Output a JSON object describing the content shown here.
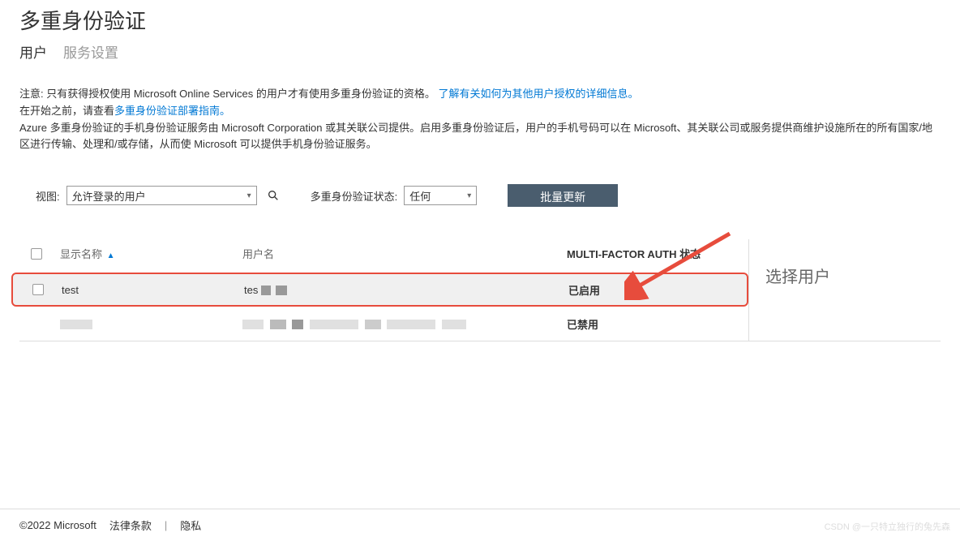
{
  "header": {
    "title": "多重身份验证",
    "tabs": {
      "users": "用户",
      "service_settings": "服务设置"
    }
  },
  "notice": {
    "line1_prefix": "注意: 只有获得授权使用 Microsoft Online Services 的用户才有使用多重身份验证的资格。 ",
    "line1_link": "了解有关如何为其他用户授权的详细信息。",
    "line2_prefix": "在开始之前，请查看",
    "line2_link": "多重身份验证部署指南。",
    "line3": "Azure 多重身份验证的手机身份验证服务由 Microsoft Corporation 或其关联公司提供。启用多重身份验证后，用户的手机号码可以在 Microsoft、其关联公司或服务提供商维护设施所在的所有国家/地区进行传输、处理和/或存储，从而使 Microsoft 可以提供手机身份验证服务。"
  },
  "toolbar": {
    "view_label": "视图:",
    "view_value": "允许登录的用户",
    "mfa_status_label": "多重身份验证状态:",
    "mfa_status_value": "任何",
    "bulk_update": "批量更新"
  },
  "table": {
    "columns": {
      "display_name": "显示名称",
      "username": "用户名",
      "mfa_status": "MULTI-FACTOR AUTH 状态"
    },
    "rows": [
      {
        "display_name": "test",
        "username": "tes",
        "status": "已启用"
      },
      {
        "display_name": "",
        "username": "",
        "status": "已禁用"
      }
    ]
  },
  "side_panel": {
    "text": "选择用户"
  },
  "footer": {
    "copyright": "©2022 Microsoft",
    "legal": "法律条款",
    "privacy": "隐私"
  },
  "watermark": "CSDN @一只特立独行的兔先森"
}
